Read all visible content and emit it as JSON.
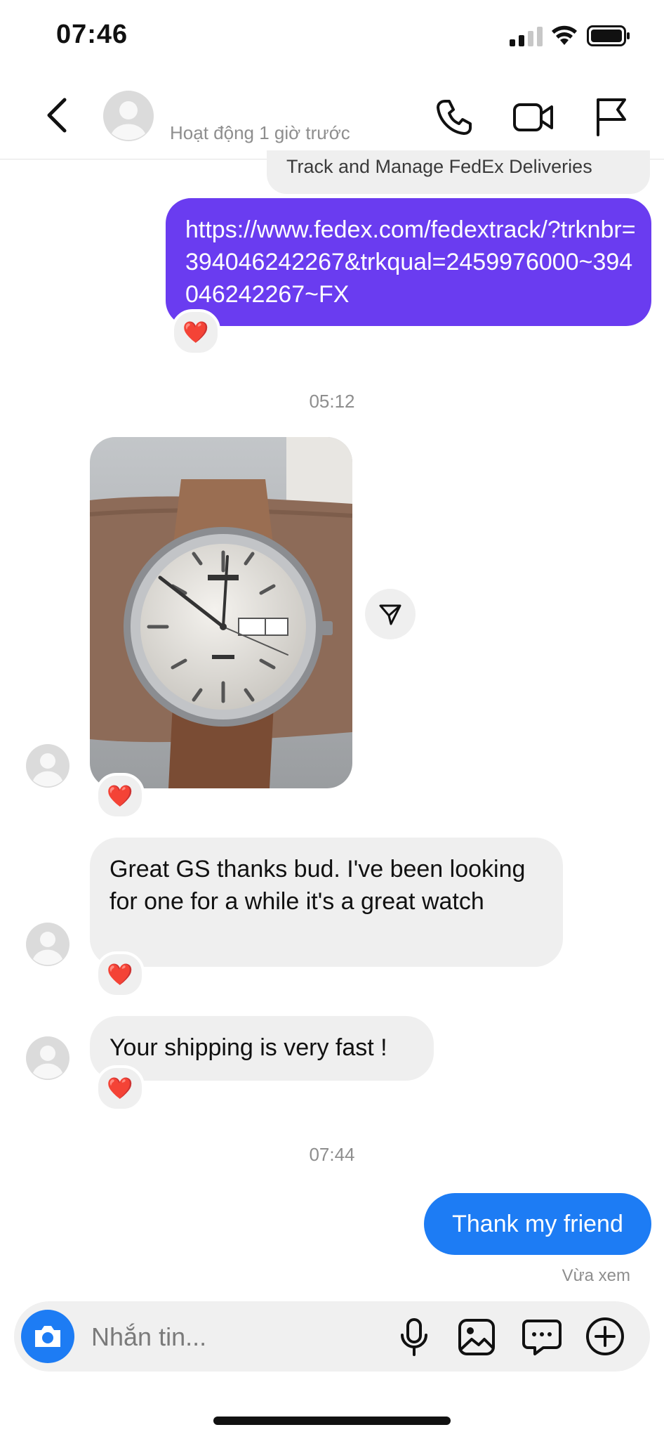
{
  "status_bar": {
    "time": "07:46"
  },
  "header": {
    "activity_status": "Hoạt động 1 giờ trước",
    "icons": [
      "back-chevron-icon",
      "avatar-placeholder-icon",
      "phone-icon",
      "video-camera-icon",
      "flag-icon"
    ]
  },
  "messages": {
    "link_preview_title": "Track and Manage FedEx Deliveries",
    "sent_link": "https://www.fedex.com/fedextrack/?trknbr=394046242267&trkqual=2459976000~394046242267~FX",
    "link_reaction": "❤️",
    "timestamp_1": "05:12",
    "photo_reaction": "❤️",
    "received_1": "Great GS thanks bud.  I've been looking for one for a while it's a great watch",
    "received_1_reaction": "❤️",
    "received_2": "Your shipping is very fast !",
    "received_2_reaction": "❤️",
    "timestamp_2": "07:44",
    "sent_reply": "Thank my friend",
    "seen_status": "Vừa xem"
  },
  "composer": {
    "placeholder": "Nhắn tin...",
    "icons": [
      "camera-icon",
      "microphone-icon",
      "gallery-icon",
      "sticker-icon",
      "plus-icon"
    ]
  },
  "colors": {
    "link_bubble": "#6a3cf0",
    "sent_bubble": "#1d7cf4",
    "received_bubble": "#efefef",
    "camera_button": "#1d7cf4"
  }
}
